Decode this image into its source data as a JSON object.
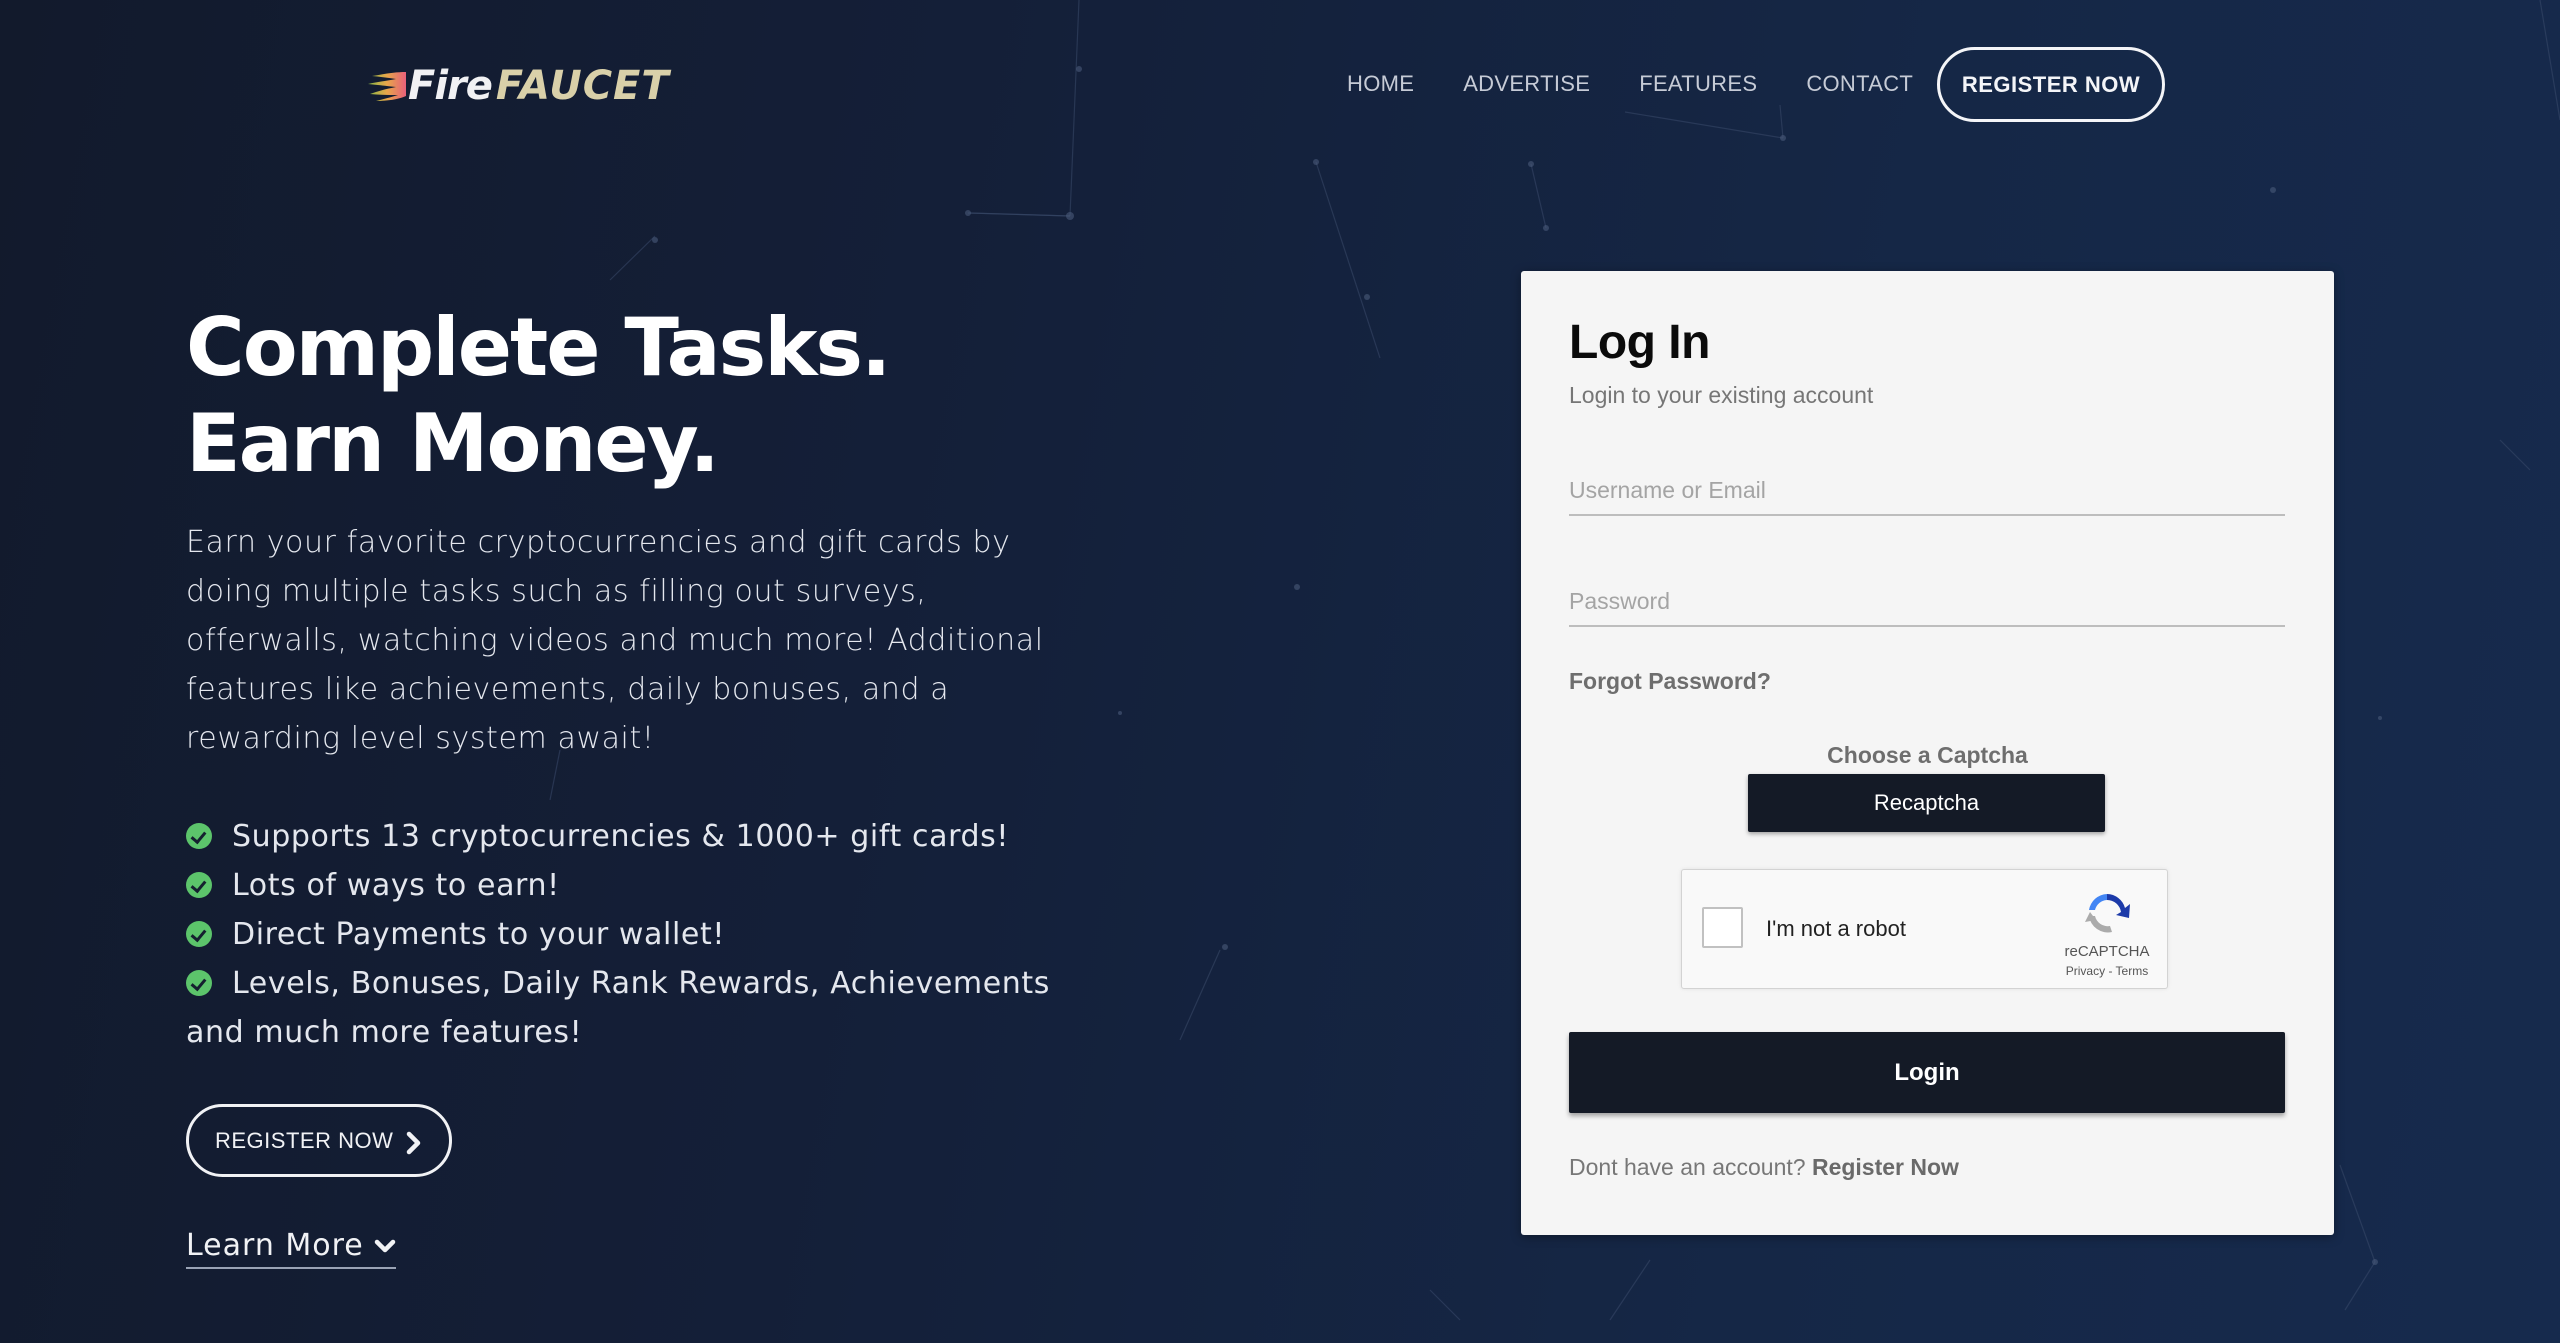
{
  "brand": {
    "part1": "Fire",
    "part2": "FAUCET",
    "primary_color": "#d9d0a9"
  },
  "nav": {
    "links": [
      {
        "label": "HOME"
      },
      {
        "label": "ADVERTISE"
      },
      {
        "label": "FEATURES"
      },
      {
        "label": "CONTACT"
      }
    ],
    "register_label": "REGISTER NOW"
  },
  "hero": {
    "title": "Complete Tasks. Earn Money.",
    "description": "Earn your favorite cryptocurrencies and gift cards by doing multiple tasks such as filling out surveys, offerwalls, watching videos and much more! Additional features like achievements, daily bonuses, and a rewarding level system await!",
    "features": [
      "Supports 13 cryptocurrencies & 1000+ gift cards!",
      "Lots of ways to earn!",
      "Direct Payments to your wallet!",
      "Levels, Bonuses, Daily Rank Rewards, Achievements and much more features!"
    ],
    "register_label": "REGISTER NOW",
    "learn_more_label": "Learn More",
    "check_color": "#5cc46b"
  },
  "login": {
    "title": "Log In",
    "subtitle": "Login to your existing account",
    "username_placeholder": "Username or Email",
    "username_value": "",
    "password_placeholder": "Password",
    "password_value": "",
    "forgot_label": "Forgot Password?",
    "captcha_label": "Choose a Captcha",
    "captcha_choice": "Recaptcha",
    "recaptcha": {
      "checkbox_label": "I'm not a robot",
      "checked": false,
      "brand": "reCAPTCHA",
      "terms": "Privacy - Terms"
    },
    "submit_label": "Login",
    "signup_prompt": "Dont have an account?",
    "signup_link": "Register Now",
    "button_color": "#141a26"
  }
}
